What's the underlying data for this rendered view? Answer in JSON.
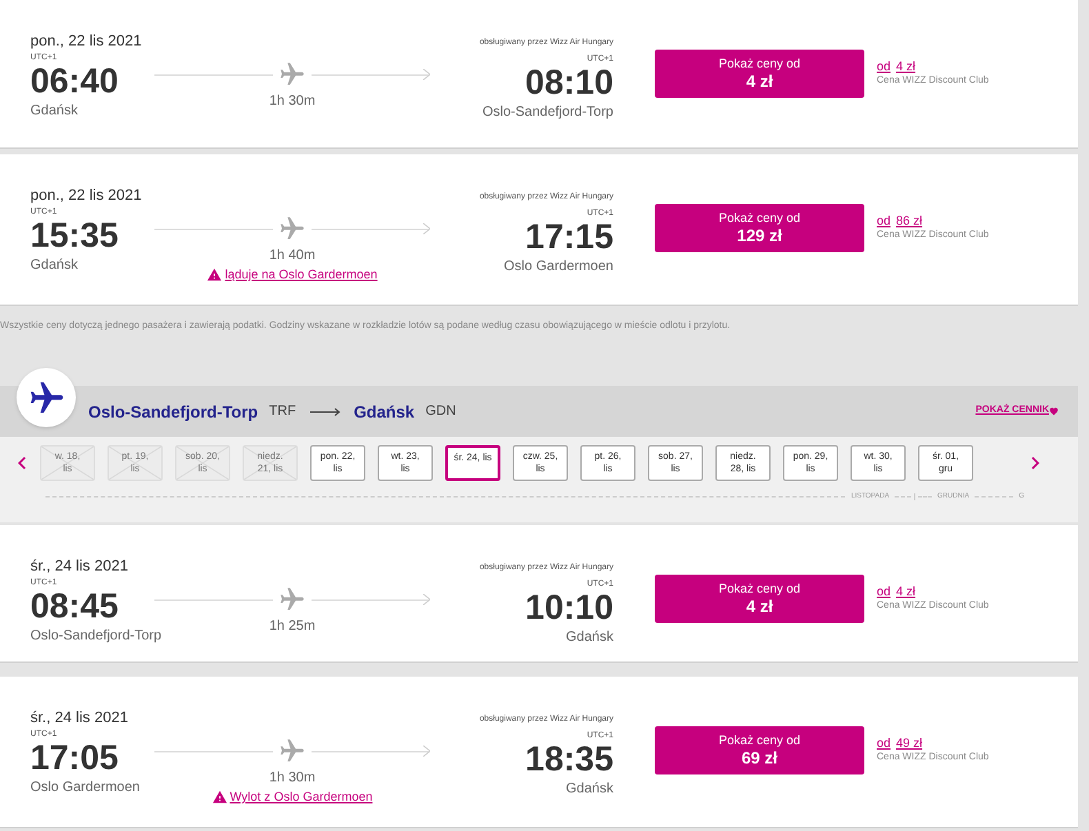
{
  "outbound_flights": [
    {
      "date": "pon., 22 lis 2021",
      "operator": "obsługiwany przez Wizz Air Hungary",
      "departure": {
        "tz": "UTC+1",
        "time": "06:40",
        "city": "Gdańsk"
      },
      "duration": "1h 30m",
      "arrival": {
        "tz": "UTC+1",
        "time": "08:10",
        "city": "Oslo-Sandefjord-Torp"
      },
      "price_button": {
        "label": "Pokaż ceny od",
        "price": "4 zł"
      },
      "club": {
        "prefix": "od",
        "price": "4 zł",
        "label": "Cena WIZZ Discount Club"
      }
    },
    {
      "date": "pon., 22 lis 2021",
      "operator": "obsługiwany przez Wizz Air Hungary",
      "departure": {
        "tz": "UTC+1",
        "time": "15:35",
        "city": "Gdańsk"
      },
      "duration": "1h 40m",
      "warning": "ląduje na Oslo Gardermoen",
      "arrival": {
        "tz": "UTC+1",
        "time": "17:15",
        "city": "Oslo Gardermoen"
      },
      "price_button": {
        "label": "Pokaż ceny od",
        "price": "129 zł"
      },
      "club": {
        "prefix": "od",
        "price": "86 zł",
        "label": "Cena WIZZ Discount Club"
      }
    }
  ],
  "note": "Wszystkie ceny dotyczą jednego pasażera i zawierają podatki. Godziny wskazane w rozkładzie lotów są podane według czasu obowiązującego w mieście odlotu i przylotu.",
  "route": {
    "origin": "Oslo-Sandefjord-Torp",
    "origin_code": "TRF",
    "destination": "Gdańsk",
    "destination_code": "GDN",
    "price_list_link": "POKAŻ CENNIK"
  },
  "dates": [
    {
      "lines": [
        "w. 18,",
        "lis"
      ],
      "disabled": true,
      "selected": false
    },
    {
      "lines": [
        "pt. 19,",
        "lis"
      ],
      "disabled": true,
      "selected": false
    },
    {
      "lines": [
        "sob. 20,",
        "lis"
      ],
      "disabled": true,
      "selected": false
    },
    {
      "lines": [
        "niedz.",
        "21, lis"
      ],
      "disabled": true,
      "selected": false
    },
    {
      "lines": [
        "pon. 22,",
        "lis"
      ],
      "disabled": false,
      "selected": false
    },
    {
      "lines": [
        "wt. 23,",
        "lis"
      ],
      "disabled": false,
      "selected": false
    },
    {
      "lines": [
        "śr. 24, lis"
      ],
      "disabled": false,
      "selected": true
    },
    {
      "lines": [
        "czw. 25,",
        "lis"
      ],
      "disabled": false,
      "selected": false
    },
    {
      "lines": [
        "pt. 26,",
        "lis"
      ],
      "disabled": false,
      "selected": false
    },
    {
      "lines": [
        "sob. 27,",
        "lis"
      ],
      "disabled": false,
      "selected": false
    },
    {
      "lines": [
        "niedz.",
        "28, lis"
      ],
      "disabled": false,
      "selected": false
    },
    {
      "lines": [
        "pon. 29,",
        "lis"
      ],
      "disabled": false,
      "selected": false
    },
    {
      "lines": [
        "wt. 30,",
        "lis"
      ],
      "disabled": false,
      "selected": false
    },
    {
      "lines": [
        "śr. 01,",
        "gru"
      ],
      "disabled": false,
      "selected": false
    }
  ],
  "months": [
    "LISTOPADA",
    "GRUDNIA",
    "G"
  ],
  "return_flights": [
    {
      "date": "śr., 24 lis 2021",
      "operator": "obsługiwany przez Wizz Air Hungary",
      "departure": {
        "tz": "UTC+1",
        "time": "08:45",
        "city": "Oslo-Sandefjord-Torp"
      },
      "duration": "1h 25m",
      "arrival": {
        "tz": "UTC+1",
        "time": "10:10",
        "city": "Gdańsk"
      },
      "price_button": {
        "label": "Pokaż ceny od",
        "price": "4 zł"
      },
      "club": {
        "prefix": "od",
        "price": "4 zł",
        "label": "Cena WIZZ Discount Club"
      }
    },
    {
      "date": "śr., 24 lis 2021",
      "operator": "obsługiwany przez Wizz Air Hungary",
      "departure": {
        "tz": "UTC+1",
        "time": "17:05",
        "city": "Oslo Gardermoen"
      },
      "duration": "1h 30m",
      "warning": "Wylot z Oslo Gardermoen",
      "arrival": {
        "tz": "UTC+1",
        "time": "18:35",
        "city": "Gdańsk"
      },
      "price_button": {
        "label": "Pokaż ceny od",
        "price": "69 zł"
      },
      "club": {
        "prefix": "od",
        "price": "49 zł",
        "label": "Cena WIZZ Discount Club"
      }
    }
  ]
}
